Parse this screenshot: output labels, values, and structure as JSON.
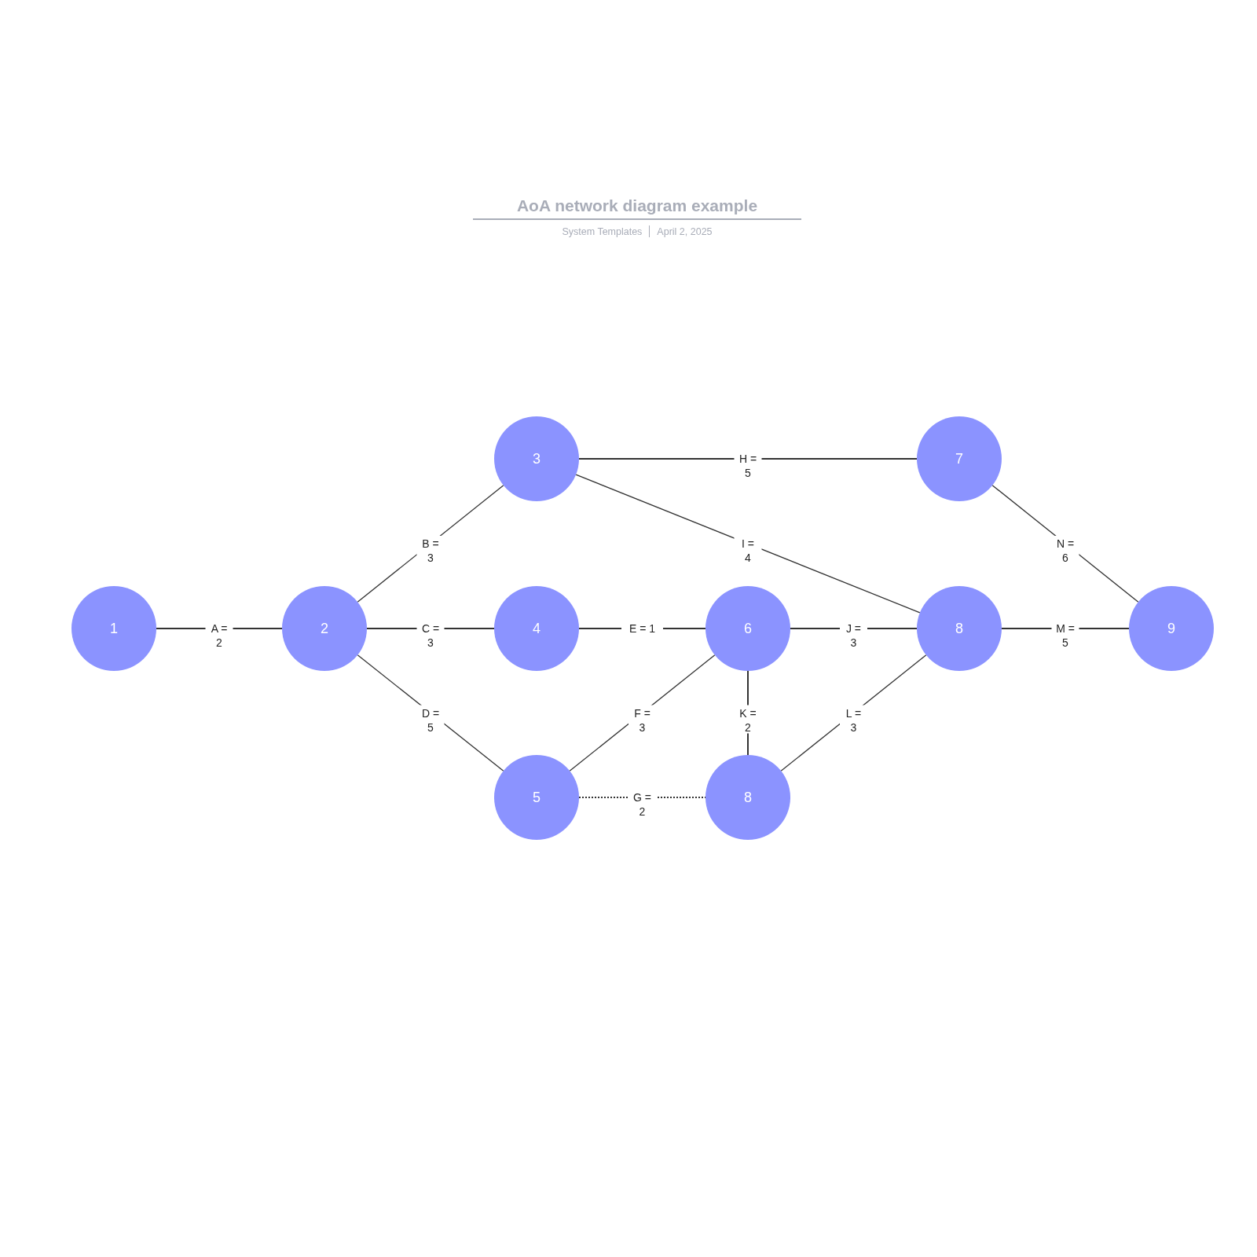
{
  "header": {
    "title": "AoA network diagram example",
    "source": "System Templates",
    "date": "April 2, 2025"
  },
  "nodes": [
    {
      "label": "1"
    },
    {
      "label": "2"
    },
    {
      "label": "3"
    },
    {
      "label": "4"
    },
    {
      "label": "6"
    },
    {
      "label": "7"
    },
    {
      "label": "8"
    },
    {
      "label": "9"
    },
    {
      "label": "5"
    },
    {
      "label": "8"
    }
  ],
  "edges": [
    {
      "label": [
        "A =",
        "2"
      ],
      "kind": "solid"
    },
    {
      "label": [
        "B =",
        "3"
      ],
      "kind": "solid"
    },
    {
      "label": [
        "C =",
        "3"
      ],
      "kind": "solid"
    },
    {
      "label": [
        "D =",
        "5"
      ],
      "kind": "solid"
    },
    {
      "label": [
        "E = 1"
      ],
      "kind": "solid"
    },
    {
      "label": [
        "F =",
        "3"
      ],
      "kind": "solid"
    },
    {
      "label": [
        "G =",
        "2"
      ],
      "kind": "dotted"
    },
    {
      "label": [
        "H =",
        "5"
      ],
      "kind": "solid"
    },
    {
      "label": [
        "I =",
        "4"
      ],
      "kind": "solid"
    },
    {
      "label": [
        "J =",
        "3"
      ],
      "kind": "solid"
    },
    {
      "label": [
        "K =",
        "2"
      ],
      "kind": "solid"
    },
    {
      "label": [
        "L =",
        "3"
      ],
      "kind": "solid"
    },
    {
      "label": [
        "M =",
        "5"
      ],
      "kind": "solid"
    },
    {
      "label": [
        "N =",
        "6"
      ],
      "kind": "solid"
    }
  ]
}
